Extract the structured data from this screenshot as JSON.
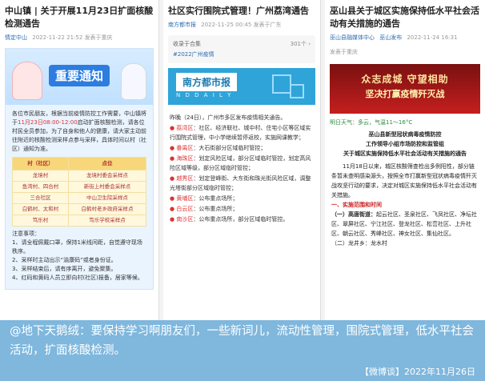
{
  "panel1": {
    "title": "中山镇 | 关于开展11月23日扩面核酸检测通告",
    "source": "情定中山",
    "date": "2022-11-22 21:52",
    "published": "发表于重庆",
    "poster": {
      "heading": "重要通知",
      "intro": "各位市民朋友，根据当前疫情防控工作需要，中山镇将于",
      "time": "11月23日08:00-12:00",
      "intro2": "启动扩面核酸检测，请各位村民全员参加，为了自身和他人的健康，请大家主动前往附近的核酸检测采样点参与采样，具体时间以村（社区）通知为准。",
      "table_headers": [
        "村（社区）",
        "点位"
      ],
      "table_rows": [
        [
          "龙境村",
          "龙境村委会采样点"
        ],
        [
          "鱼湾村、四合村",
          "新街上村委会采样点"
        ],
        [
          "三合社区",
          "中山卫生院采样点"
        ],
        [
          "白鹤村、太和村",
          "白鹤村老乡政府采样点"
        ],
        [
          "笃乐村",
          "笃乐学校采样点"
        ]
      ],
      "notes_title": "注意事项：",
      "notes": [
        "1、请全程佩戴口罩，保持1米线间距，自觉遵守现场秩序。",
        "2、采样时主动出示“渝康码”或者身份证。",
        "3、采样结束后，请有序离开，避免聚集。",
        "4、红码和黄码人员立即向村(社区)报备，居家等候。"
      ]
    }
  },
  "panel2": {
    "title": "社区实行围院式管理！广州荔湾通告",
    "source": "南方都市报",
    "date": "2022-11-25 00:45",
    "published": "发表于广东",
    "collection_label": "收录于合集",
    "collection_tag": "#2022广州疫情",
    "collection_count": "301个 ›",
    "banner_brand": "南方都市报",
    "banner_sub": "N D D A I L Y",
    "intro": "昨晚（24日），广州市多区发布疫情相关通告。",
    "items": [
      {
        "name": "荔湾区",
        "text": "：社区、经济联社、城中村、住宅小区等区域实行围院式管理，中小学继续暂停返校，实施网课教学；"
      },
      {
        "name": "番禺区",
        "text": "：大石街部分区域临时管控；"
      },
      {
        "name": "海珠区",
        "text": "：划定风险区域，部分区域临时管控，划定高风险区域等级，部分区域临时管控；"
      },
      {
        "name": "越秀区",
        "text": "：划定登峰街、大东街和珠光街风险区域，调整光塔街部分区域临时管控；"
      },
      {
        "name": "黄埔区",
        "text": "：公布重点场所；"
      },
      {
        "name": "白云区",
        "text": "：公布重点场所；"
      },
      {
        "name": "南沙区",
        "text": "：公布重点场所，部分区域临时管控。"
      }
    ]
  },
  "panel3": {
    "title": "巫山县关于城区实施保持低水平社会活动有关措施的通告",
    "source": "巫山县融媒体中心",
    "source2": "巫山发布",
    "date": "2022-11-24 16:31",
    "published": "发表于重庆",
    "banner_line1": "众志成城 守望相助",
    "banner_line2": "坚决打赢疫情歼灭战",
    "weather": "明日天气：多云，气温11～16°C",
    "doc_header1": "巫山县新型冠状病毒疫情防控",
    "doc_header2": "工作领导小组市场防控和监管组",
    "doc_header3": "关于城区实施保持低水平社会活动有关措施的通告",
    "doc_body": "11月18日以来，城区核酸筛查检出多例阳性，部分链条暂未查明感染源头，按照全市打赢新型冠状病毒疫情歼灭战攻坚行动的要求，决定对城区实施保持低水平社会活动有关措施。",
    "section": "一、实施范围和时间",
    "street_label": "（一）高唐街道：",
    "street_text": "起云社区、圣泉社区、飞凤社区、净坛社区、翠屏社区、宁江社区、登龙社区、松峦社区、上升社区、朝云社区、秀峰社区、神女社区、集仙社区。",
    "tail": "（二）龙井乡：龙水村"
  },
  "caption": {
    "text": "@地下天鹅绒：要保持学习啊朋友们，一些新词儿，流动性管理，围院式管理，低水平社会活动，扩面核酸检测。",
    "source": "【微博谈】2022年11月26日"
  },
  "colors": {
    "caption_bg": "#7fb7dd",
    "accent_blue": "#2d7de0",
    "alert_red": "#d33",
    "banner_red": "#c51f1f"
  }
}
